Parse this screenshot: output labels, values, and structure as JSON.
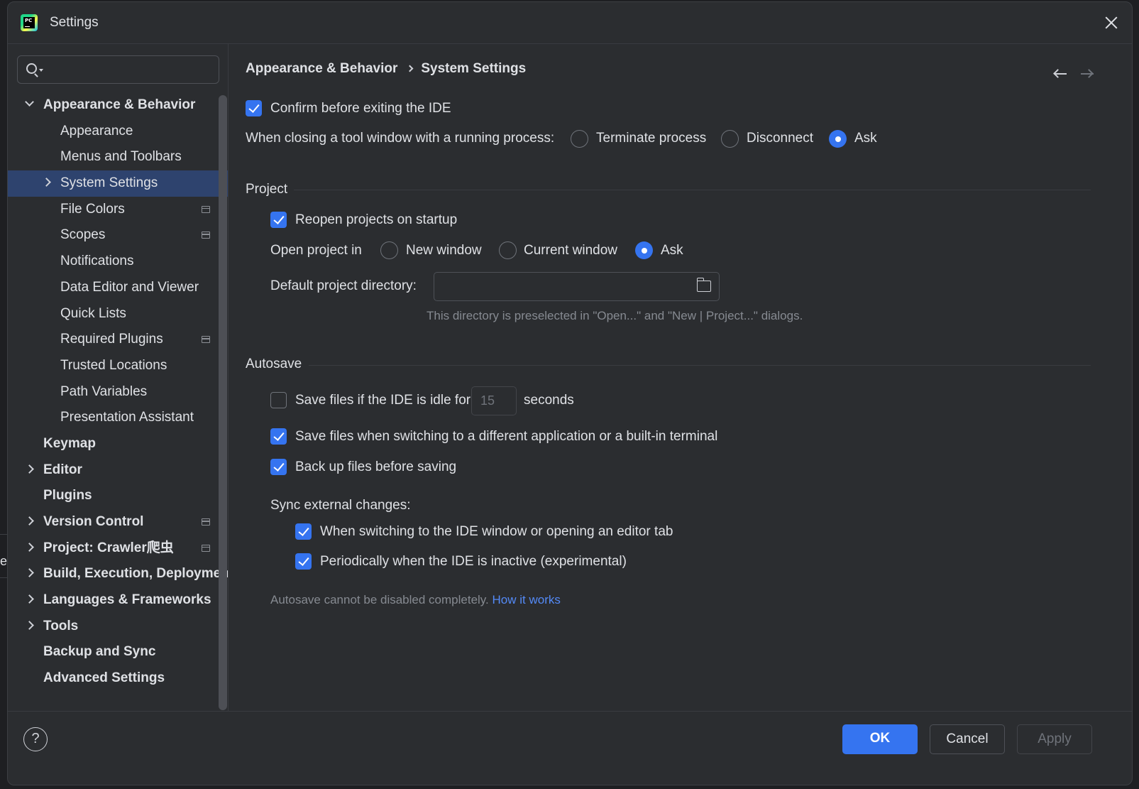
{
  "window": {
    "title": "Settings",
    "app_logo_text": "PC"
  },
  "search": {
    "placeholder": "",
    "value": ""
  },
  "sidebar": {
    "items": [
      {
        "label": "Appearance & Behavior",
        "level": 0,
        "bold": true,
        "chevron": "down",
        "selected": false,
        "project_icon": false
      },
      {
        "label": "Appearance",
        "level": 1,
        "bold": false,
        "chevron": "",
        "selected": false,
        "project_icon": false
      },
      {
        "label": "Menus and Toolbars",
        "level": 1,
        "bold": false,
        "chevron": "",
        "selected": false,
        "project_icon": false
      },
      {
        "label": "System Settings",
        "level": 1,
        "bold": false,
        "chevron": "right",
        "selected": true,
        "project_icon": false
      },
      {
        "label": "File Colors",
        "level": 1,
        "bold": false,
        "chevron": "",
        "selected": false,
        "project_icon": true
      },
      {
        "label": "Scopes",
        "level": 1,
        "bold": false,
        "chevron": "",
        "selected": false,
        "project_icon": true
      },
      {
        "label": "Notifications",
        "level": 1,
        "bold": false,
        "chevron": "",
        "selected": false,
        "project_icon": false
      },
      {
        "label": "Data Editor and Viewer",
        "level": 1,
        "bold": false,
        "chevron": "",
        "selected": false,
        "project_icon": false
      },
      {
        "label": "Quick Lists",
        "level": 1,
        "bold": false,
        "chevron": "",
        "selected": false,
        "project_icon": false
      },
      {
        "label": "Required Plugins",
        "level": 1,
        "bold": false,
        "chevron": "",
        "selected": false,
        "project_icon": true
      },
      {
        "label": "Trusted Locations",
        "level": 1,
        "bold": false,
        "chevron": "",
        "selected": false,
        "project_icon": false
      },
      {
        "label": "Path Variables",
        "level": 1,
        "bold": false,
        "chevron": "",
        "selected": false,
        "project_icon": false
      },
      {
        "label": "Presentation Assistant",
        "level": 1,
        "bold": false,
        "chevron": "",
        "selected": false,
        "project_icon": false
      },
      {
        "label": "Keymap",
        "level": 0,
        "bold": true,
        "chevron": "",
        "selected": false,
        "project_icon": false
      },
      {
        "label": "Editor",
        "level": 0,
        "bold": true,
        "chevron": "right",
        "selected": false,
        "project_icon": false
      },
      {
        "label": "Plugins",
        "level": 0,
        "bold": true,
        "chevron": "",
        "selected": false,
        "project_icon": false
      },
      {
        "label": "Version Control",
        "level": 0,
        "bold": true,
        "chevron": "right",
        "selected": false,
        "project_icon": true
      },
      {
        "label": "Project: Crawler爬虫",
        "level": 0,
        "bold": true,
        "chevron": "right",
        "selected": false,
        "project_icon": true
      },
      {
        "label": "Build, Execution, Deployment",
        "level": 0,
        "bold": true,
        "chevron": "right",
        "selected": false,
        "project_icon": false
      },
      {
        "label": "Languages & Frameworks",
        "level": 0,
        "bold": true,
        "chevron": "right",
        "selected": false,
        "project_icon": false
      },
      {
        "label": "Tools",
        "level": 0,
        "bold": true,
        "chevron": "right",
        "selected": false,
        "project_icon": false
      },
      {
        "label": "Backup and Sync",
        "level": 0,
        "bold": true,
        "chevron": "",
        "selected": false,
        "project_icon": false
      },
      {
        "label": "Advanced Settings",
        "level": 0,
        "bold": true,
        "chevron": "",
        "selected": false,
        "project_icon": false
      }
    ]
  },
  "breadcrumb": {
    "parent": "Appearance & Behavior",
    "current": "System Settings"
  },
  "general": {
    "confirm_exit": {
      "label": "Confirm before exiting the IDE",
      "checked": true
    },
    "tool_window_label": "When closing a tool window with a running process:",
    "tool_window_options": [
      {
        "label": "Terminate process",
        "selected": false
      },
      {
        "label": "Disconnect",
        "selected": false
      },
      {
        "label": "Ask",
        "selected": true
      }
    ]
  },
  "project": {
    "section_title": "Project",
    "reopen": {
      "label": "Reopen projects on startup",
      "checked": true
    },
    "open_in_label": "Open project in",
    "open_in_options": [
      {
        "label": "New window",
        "selected": false
      },
      {
        "label": "Current window",
        "selected": false
      },
      {
        "label": "Ask",
        "selected": true
      }
    ],
    "default_dir_label": "Default project directory:",
    "default_dir_value": "",
    "default_dir_hint": "This directory is preselected in \"Open...\" and \"New | Project...\" dialogs."
  },
  "autosave": {
    "section_title": "Autosave",
    "idle": {
      "label": "Save files if the IDE is idle for",
      "checked": false,
      "value": "15",
      "suffix": "seconds"
    },
    "switching": {
      "label": "Save files when switching to a different application or a built-in terminal",
      "checked": true
    },
    "backup": {
      "label": "Back up files before saving",
      "checked": true
    },
    "sync_label": "Sync external changes:",
    "sync_switch": {
      "label": "When switching to the IDE window or opening an editor tab",
      "checked": true
    },
    "sync_periodic": {
      "label": "Periodically when the IDE is inactive (experimental)",
      "checked": true
    },
    "note": "Autosave cannot be disabled completely.",
    "note_link": "How it works"
  },
  "footer": {
    "help": "?",
    "ok": "OK",
    "cancel": "Cancel",
    "apply": "Apply"
  },
  "background_fragment": "e",
  "colors": {
    "accent": "#3574f0",
    "selection": "#2e436e",
    "link": "#548af7",
    "panel": "#2b2d30"
  }
}
